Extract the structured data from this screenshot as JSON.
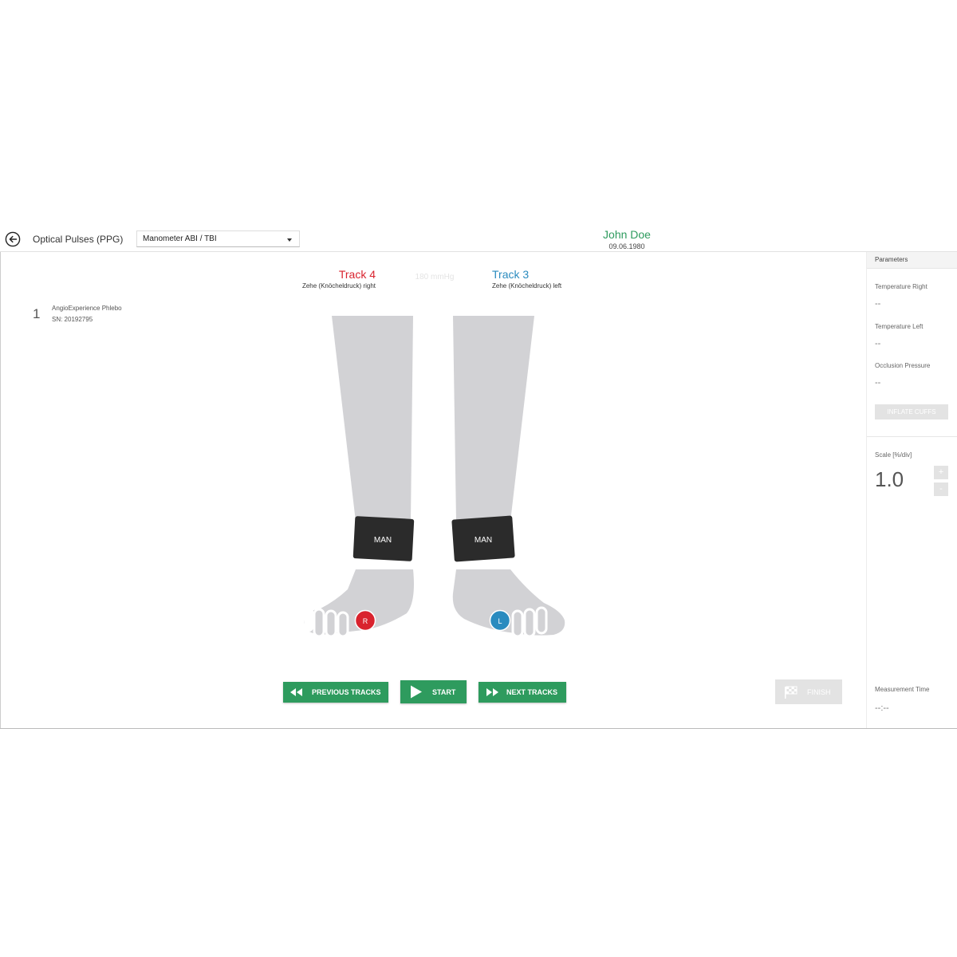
{
  "header": {
    "title": "Optical Pulses (PPG)",
    "dropdown_value": "Manometer ABI / TBI",
    "patient_name": "John Doe",
    "patient_dob": "09.06.1980"
  },
  "device": {
    "number": "1",
    "name": "AngioExperience Phlebo",
    "serial": "SN: 20192795"
  },
  "tracks": {
    "right_title": "Track 4",
    "right_sub": "Zehe (Knöcheldruck) right",
    "pressure": "180 mmHg",
    "left_title": "Track 3",
    "left_sub": "Zehe (Knöcheldruck) left"
  },
  "cuffs": {
    "right": "MAN",
    "left": "MAN"
  },
  "markers": {
    "right": "R",
    "left": "L"
  },
  "buttons": {
    "previous": "PREVIOUS TRACKS",
    "start": "START",
    "next": "NEXT TRACKS",
    "finish": "FINISH"
  },
  "panel": {
    "header": "Parameters",
    "temp_right_label": "Temperature Right",
    "temp_right_value": "--",
    "temp_left_label": "Temperature Left",
    "temp_left_value": "--",
    "occlusion_label": "Occlusion Pressure",
    "occlusion_value": "--",
    "inflate_label": "INFLATE CUFFS",
    "scale_label": "Scale [%/div]",
    "scale_value": "1.0",
    "plus": "+",
    "minus": "-",
    "time_label": "Measurement Time",
    "time_value": "--:--"
  },
  "colors": {
    "accent": "#2e9b5e",
    "right_track": "#d9232e",
    "left_track": "#2a8bbf",
    "leg": "#d2d2d5",
    "cuff": "#2b2b2b"
  }
}
